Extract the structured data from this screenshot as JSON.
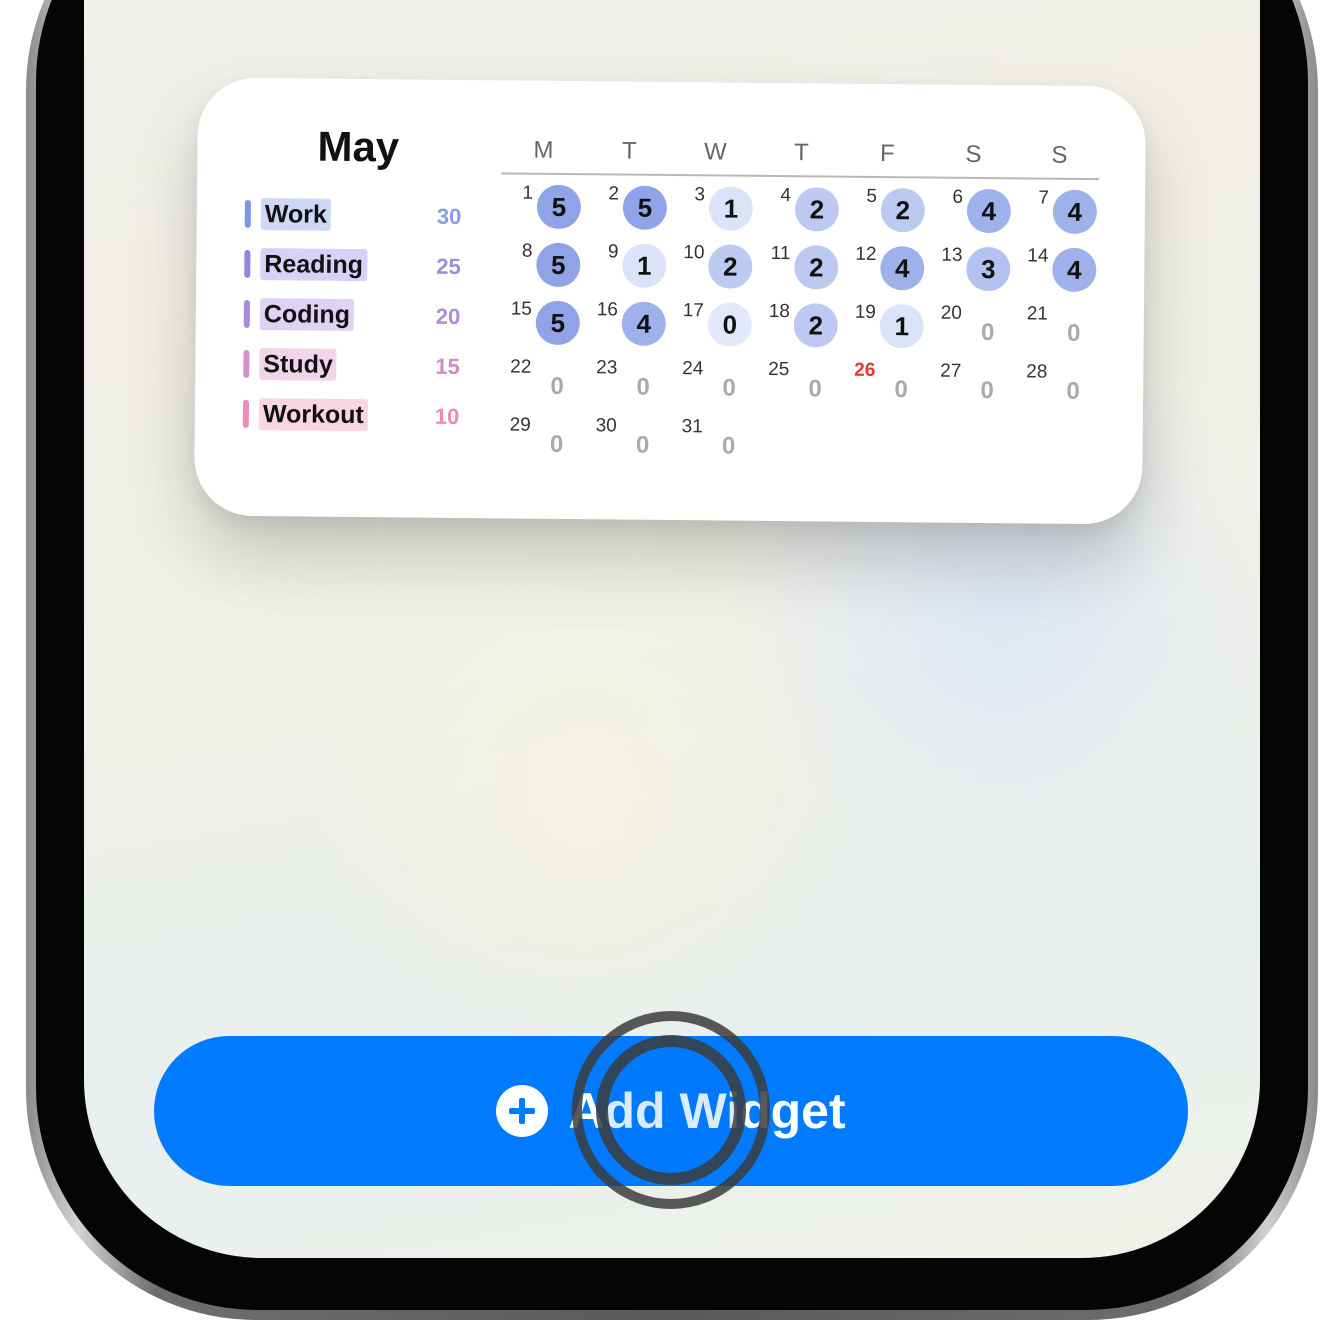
{
  "widget": {
    "month": "May",
    "weekdays": [
      "M",
      "T",
      "W",
      "T",
      "F",
      "S",
      "S"
    ],
    "categories": [
      {
        "label": "Work",
        "count": "30",
        "color": "#8a9ee6",
        "bar": "#7f95e8",
        "bg": "#cdd7f6"
      },
      {
        "label": "Reading",
        "count": "25",
        "color": "#9a8fe0",
        "bar": "#8f86e6",
        "bg": "#d6d1f5"
      },
      {
        "label": "Coding",
        "count": "20",
        "color": "#b48ad8",
        "bar": "#a889dc",
        "bg": "#e0d2f2"
      },
      {
        "label": "Study",
        "count": "15",
        "color": "#d08ac6",
        "bar": "#d293cd",
        "bg": "#f0d4ea"
      },
      {
        "label": "Workout",
        "count": "10",
        "color": "#ee8ab0",
        "bar": "#f08aba",
        "bg": "#fad6e4"
      }
    ],
    "days": [
      {
        "d": "1",
        "c": "5"
      },
      {
        "d": "2",
        "c": "5"
      },
      {
        "d": "3",
        "c": "1"
      },
      {
        "d": "4",
        "c": "2"
      },
      {
        "d": "5",
        "c": "2"
      },
      {
        "d": "6",
        "c": "4"
      },
      {
        "d": "7",
        "c": "4"
      },
      {
        "d": "8",
        "c": "5"
      },
      {
        "d": "9",
        "c": "1"
      },
      {
        "d": "10",
        "c": "2"
      },
      {
        "d": "11",
        "c": "2"
      },
      {
        "d": "12",
        "c": "4"
      },
      {
        "d": "13",
        "c": "3"
      },
      {
        "d": "14",
        "c": "4"
      },
      {
        "d": "15",
        "c": "5"
      },
      {
        "d": "16",
        "c": "4"
      },
      {
        "d": "17",
        "c": "0"
      },
      {
        "d": "18",
        "c": "2"
      },
      {
        "d": "19",
        "c": "1"
      },
      {
        "d": "20",
        "c": "0"
      },
      {
        "d": "21",
        "c": "0"
      },
      {
        "d": "22",
        "c": "0"
      },
      {
        "d": "23",
        "c": "0"
      },
      {
        "d": "24",
        "c": "0"
      },
      {
        "d": "25",
        "c": "0"
      },
      {
        "d": "26",
        "c": "0",
        "today": true
      },
      {
        "d": "27",
        "c": "0"
      },
      {
        "d": "28",
        "c": "0"
      },
      {
        "d": "29",
        "c": "0"
      },
      {
        "d": "30",
        "c": "0"
      },
      {
        "d": "31",
        "c": "0"
      }
    ]
  },
  "button": {
    "label": "Add Widget",
    "icon": "plus-circle-icon",
    "color": "#007aff"
  }
}
